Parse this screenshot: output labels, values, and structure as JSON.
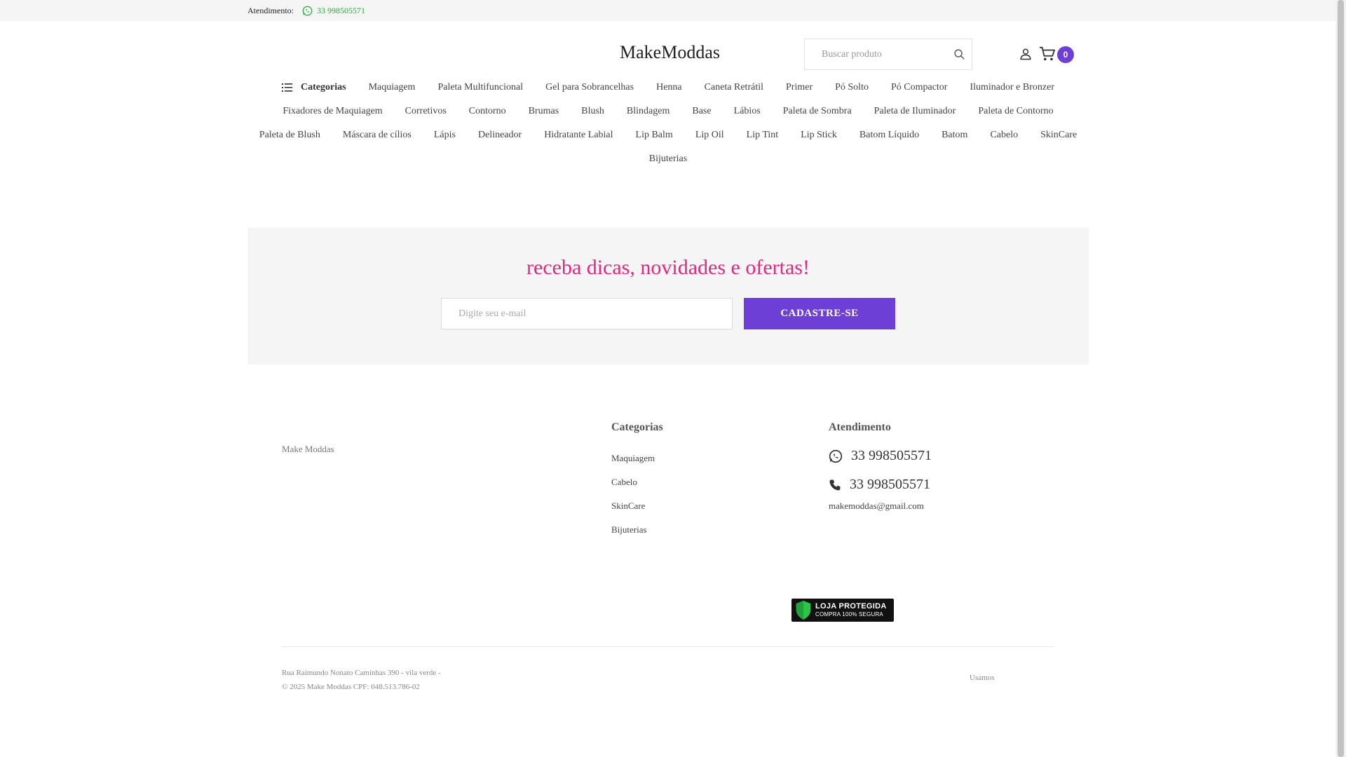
{
  "topbar": {
    "label": "Atendimento:",
    "phone": "33 998505571"
  },
  "header": {
    "logo": "MakeModdas",
    "search_placeholder": "Buscar produto",
    "cart_count": "0"
  },
  "nav": {
    "categories_label": "Categorias",
    "rows": [
      [
        "Maquiagem",
        "Paleta Multifuncional",
        "Gel para Sobrancelhas",
        "Henna",
        "Caneta Retrátil",
        "Primer",
        "Pó Solto",
        "Pó Compactor",
        "Iluminador e Bronzer"
      ],
      [
        "Fixadores de Maquiagem",
        "Corretivos",
        "Contorno",
        "Brumas",
        "Blush",
        "Blindagem",
        "Base",
        "Lábios",
        "Paleta de Sombra",
        "Paleta de Iluminador",
        "Paleta de Contorno"
      ],
      [
        "Paleta de Blush",
        "Máscara de cílios",
        "Lápis",
        "Delineador",
        "Hidratante Labial",
        "Lip Balm",
        "Lip Oil",
        "Lip Tint",
        "Lip Stick",
        "Batom Líquido",
        "Batom",
        "Cabelo",
        "SkinCare"
      ],
      [
        "Bijuterias"
      ]
    ]
  },
  "newsletter": {
    "title": "receba dicas, novidades e ofertas!",
    "email_placeholder": "Digite seu e-mail",
    "button_label": "CADASTRE-SE"
  },
  "footer": {
    "brand": "Make Moddas",
    "categories_title": "Categorias",
    "categories": [
      "Maquiagem",
      "Cabelo",
      "SkinCare",
      "Bijuterias"
    ],
    "contact_title": "Atendimento",
    "whatsapp": "33 998505571",
    "phone": "33 998505571",
    "email": "makemoddas@gmail.com",
    "seal_line1": "LOJA PROTEGIDA",
    "seal_line2": "COMPRA 100% SEGURA",
    "address": "Rua Raimundo Nonato Caminhas 390 - vila verde -",
    "copyright": "© 2025 Make Moddas CPF: 048.513.786-02",
    "usamos": "Usamos"
  },
  "colors": {
    "accent": "#6e3fd6",
    "headline": "#e6277f",
    "whatsapp": "#27a844"
  }
}
